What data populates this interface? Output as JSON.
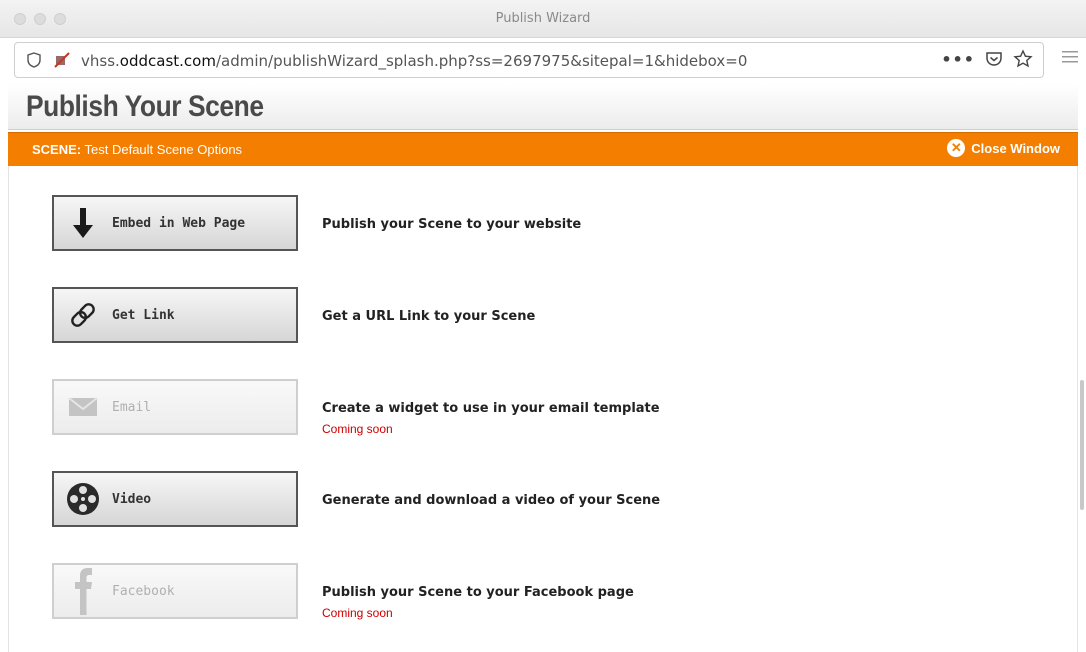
{
  "window": {
    "title": "Publish Wizard"
  },
  "urlbar": {
    "host": "vhss.oddcast.com",
    "path": "/admin/publishWizard_splash.php?ss=2697975&sitepal=1&hidebox=0",
    "prefix": "vhss.",
    "domain": "oddcast.com"
  },
  "header": {
    "title": "Publish Your Scene"
  },
  "scene_bar": {
    "label": "SCENE:",
    "name": "Test Default Scene Options",
    "close": "Close Window"
  },
  "options": [
    {
      "button": "Embed in Web Page",
      "description": "Publish your Scene to your website",
      "note": "",
      "enabled": true,
      "icon": "download-arrow-icon"
    },
    {
      "button": "Get Link",
      "description": "Get a URL Link to your Scene",
      "note": "",
      "enabled": true,
      "icon": "link-icon"
    },
    {
      "button": "Email",
      "description": "Create a widget to use in your email template",
      "note": "Coming soon",
      "enabled": false,
      "icon": "envelope-icon"
    },
    {
      "button": "Video",
      "description": "Generate and download a video of your Scene",
      "note": "",
      "enabled": true,
      "icon": "film-reel-icon"
    },
    {
      "button": "Facebook",
      "description": "Publish your Scene to your Facebook page",
      "note": "Coming soon",
      "enabled": false,
      "icon": "facebook-icon"
    }
  ],
  "colors": {
    "accent": "#f47e00",
    "coming_soon": "#cc0000"
  }
}
